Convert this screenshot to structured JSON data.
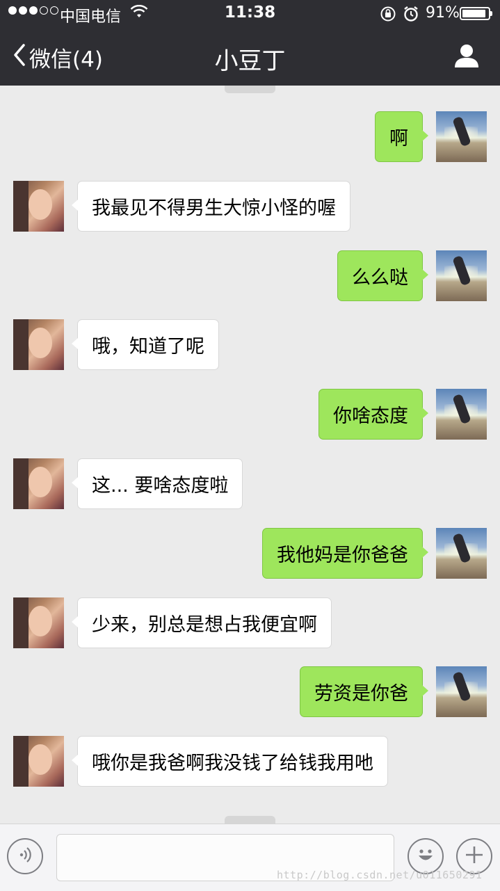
{
  "status_bar": {
    "carrier": "中国电信",
    "time": "11:38",
    "battery_percent": "91%",
    "battery_level": 0.91,
    "signal_dots_full": 3,
    "signal_dots_total": 5
  },
  "nav": {
    "back_label": "微信(4)",
    "title": "小豆丁",
    "profile_icon": "person-icon"
  },
  "messages": [
    {
      "from": "me",
      "text": "啊"
    },
    {
      "from": "her",
      "text": "我最见不得男生大惊小怪的喔"
    },
    {
      "from": "me",
      "text": "么么哒"
    },
    {
      "from": "her",
      "text": "哦，知道了呢"
    },
    {
      "from": "me",
      "text": "你啥态度"
    },
    {
      "from": "her",
      "text": "这... 要啥态度啦"
    },
    {
      "from": "me",
      "text": "我他妈是你爸爸"
    },
    {
      "from": "her",
      "text": "少来，别总是想占我便宜啊"
    },
    {
      "from": "me",
      "text": "劳资是你爸"
    },
    {
      "from": "her",
      "text": "哦你是我爸啊我没钱了给钱我用吔"
    }
  ],
  "input_bar": {
    "voice_icon": "voice-icon",
    "emoji_icon": "emoji-icon",
    "plus_icon": "plus-icon",
    "text_value": ""
  },
  "watermark": "http://blog.csdn.net/u011650291",
  "colors": {
    "nav_bg": "#2e2e33",
    "chat_bg": "#ebebeb",
    "my_bubble": "#9ee65c",
    "their_bubble": "#ffffff"
  }
}
